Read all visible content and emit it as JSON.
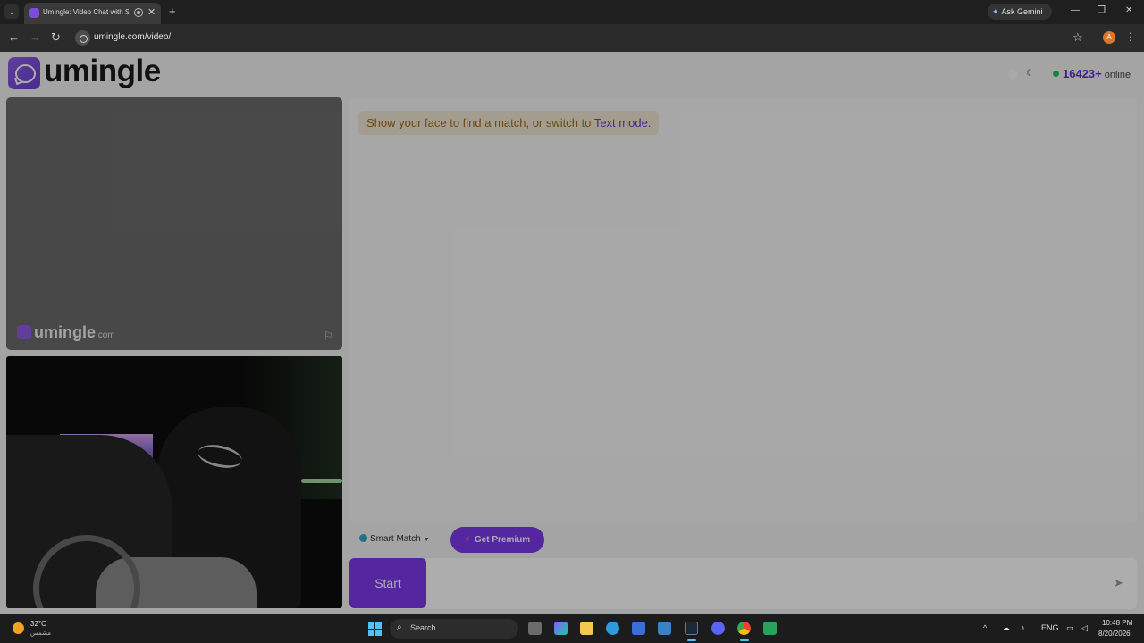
{
  "browser": {
    "tab_title": "Umingle: Video Chat with S",
    "new_tab": "+",
    "tab_close": "✕",
    "tab_list": "⌄",
    "ask_gemini": "Ask Gemini",
    "url": "umingle.com/video/",
    "profile_initial": "A",
    "window_controls": {
      "minimize": "—",
      "restore": "❐",
      "close": "✕"
    }
  },
  "site": {
    "logo_text": "umingle",
    "online_count": "16423+",
    "online_label": "online",
    "watermark_name": "umingle",
    "watermark_suffix": ".com"
  },
  "chat": {
    "notice_text": "Show your face to find a match, or switch to ",
    "notice_link": "Text mode."
  },
  "controls": {
    "smart_match_label": "Smart Match",
    "get_premium_label": "Get Premium",
    "start_label": "Start"
  },
  "taskbar": {
    "weather_temp": "32°C",
    "weather_desc": "مشمس",
    "search_label": "Search",
    "language": "ENG",
    "time": "10:48 PM",
    "date": "8/20/2026"
  },
  "colors": {
    "accent": "#7c3aed",
    "online_dot": "#22c55e",
    "notice_text": "#a56a1c",
    "notice_bg": "#efe7d2"
  },
  "icons": {
    "moon": "☾",
    "flag": "⚐",
    "send": "➤",
    "bolt": "⚡",
    "star": "✦",
    "bookmark": "☆",
    "menu": "⋮",
    "back": "←",
    "forward": "→",
    "reload": "↻",
    "magnifier": "⌕",
    "caret": "▼"
  }
}
